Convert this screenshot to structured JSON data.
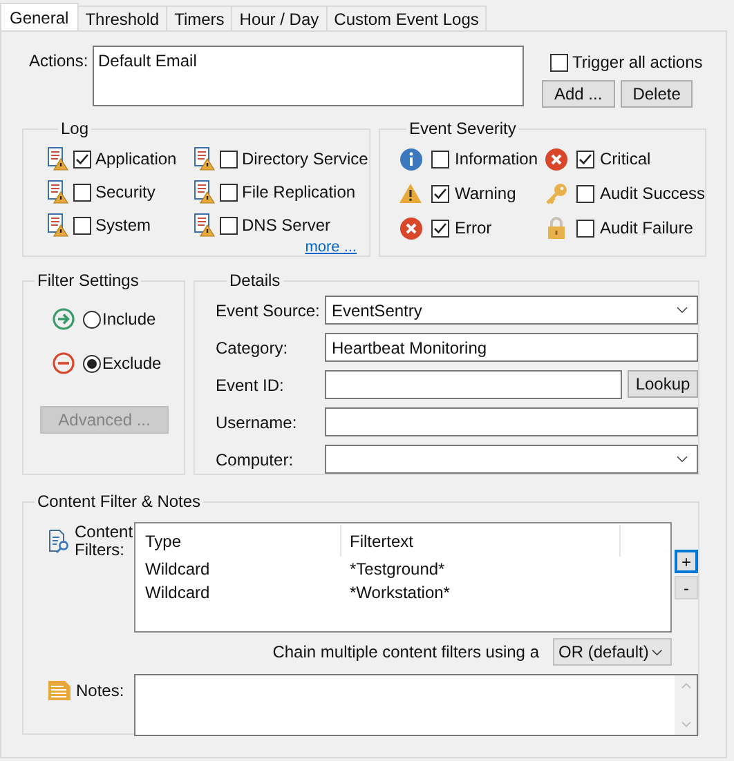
{
  "tabs": [
    {
      "label": "General",
      "selected": true
    },
    {
      "label": "Threshold",
      "selected": false
    },
    {
      "label": "Timers",
      "selected": false
    },
    {
      "label": "Hour / Day",
      "selected": false
    },
    {
      "label": "Custom Event Logs",
      "selected": false
    }
  ],
  "actions": {
    "label": "Actions:",
    "items": [
      "Default Email"
    ],
    "trigger_all": {
      "label": "Trigger all actions",
      "checked": false
    },
    "buttons": [
      "Add ...",
      "Delete"
    ]
  },
  "log": {
    "title": "Log",
    "items": [
      {
        "label": "Application",
        "checked": true
      },
      {
        "label": "Directory Service",
        "checked": false
      },
      {
        "label": "Security",
        "checked": false
      },
      {
        "label": "File Replication",
        "checked": false
      },
      {
        "label": "System",
        "checked": false
      },
      {
        "label": "DNS Server",
        "checked": false
      }
    ],
    "more_link": "more ..."
  },
  "event_severity": {
    "title": "Event Severity",
    "items": [
      {
        "kind": "information",
        "label": "Information",
        "checked": false
      },
      {
        "kind": "critical",
        "label": "Critical",
        "checked": true
      },
      {
        "kind": "warning",
        "label": "Warning",
        "checked": true
      },
      {
        "kind": "audit_success",
        "label": "Audit Success",
        "checked": false
      },
      {
        "kind": "error",
        "label": "Error",
        "checked": true
      },
      {
        "kind": "audit_failure",
        "label": "Audit Failure",
        "checked": false
      }
    ]
  },
  "filter_settings": {
    "title": "Filter Settings",
    "options": [
      {
        "kind": "include",
        "label": "Include",
        "selected": false
      },
      {
        "kind": "exclude",
        "label": "Exclude",
        "selected": true
      }
    ],
    "advanced_button": {
      "label": "Advanced ...",
      "disabled": true
    }
  },
  "details": {
    "title": "Details",
    "fields": [
      {
        "kind": "dropdown",
        "label": "Event Source:",
        "value": "EventSentry"
      },
      {
        "kind": "text",
        "label": "Category:",
        "value": "Heartbeat Monitoring"
      },
      {
        "kind": "text",
        "label": "Event ID:",
        "button": "Lookup"
      },
      {
        "kind": "text",
        "label": "Username:"
      },
      {
        "kind": "dropdown",
        "label": "Computer:"
      }
    ]
  },
  "content_filter": {
    "title": "Content Filter & Notes",
    "label": "Content Filters:",
    "columns": [
      "Type",
      "Filtertext"
    ],
    "rows": [
      [
        "Wildcard",
        "*Testground*"
      ],
      [
        "Wildcard",
        "*Workstation*"
      ]
    ],
    "add_button": "+",
    "remove_button": "-",
    "chain_label": "Chain multiple content filters using a",
    "chain_value": "OR (default)",
    "notes_label": "Notes:"
  }
}
